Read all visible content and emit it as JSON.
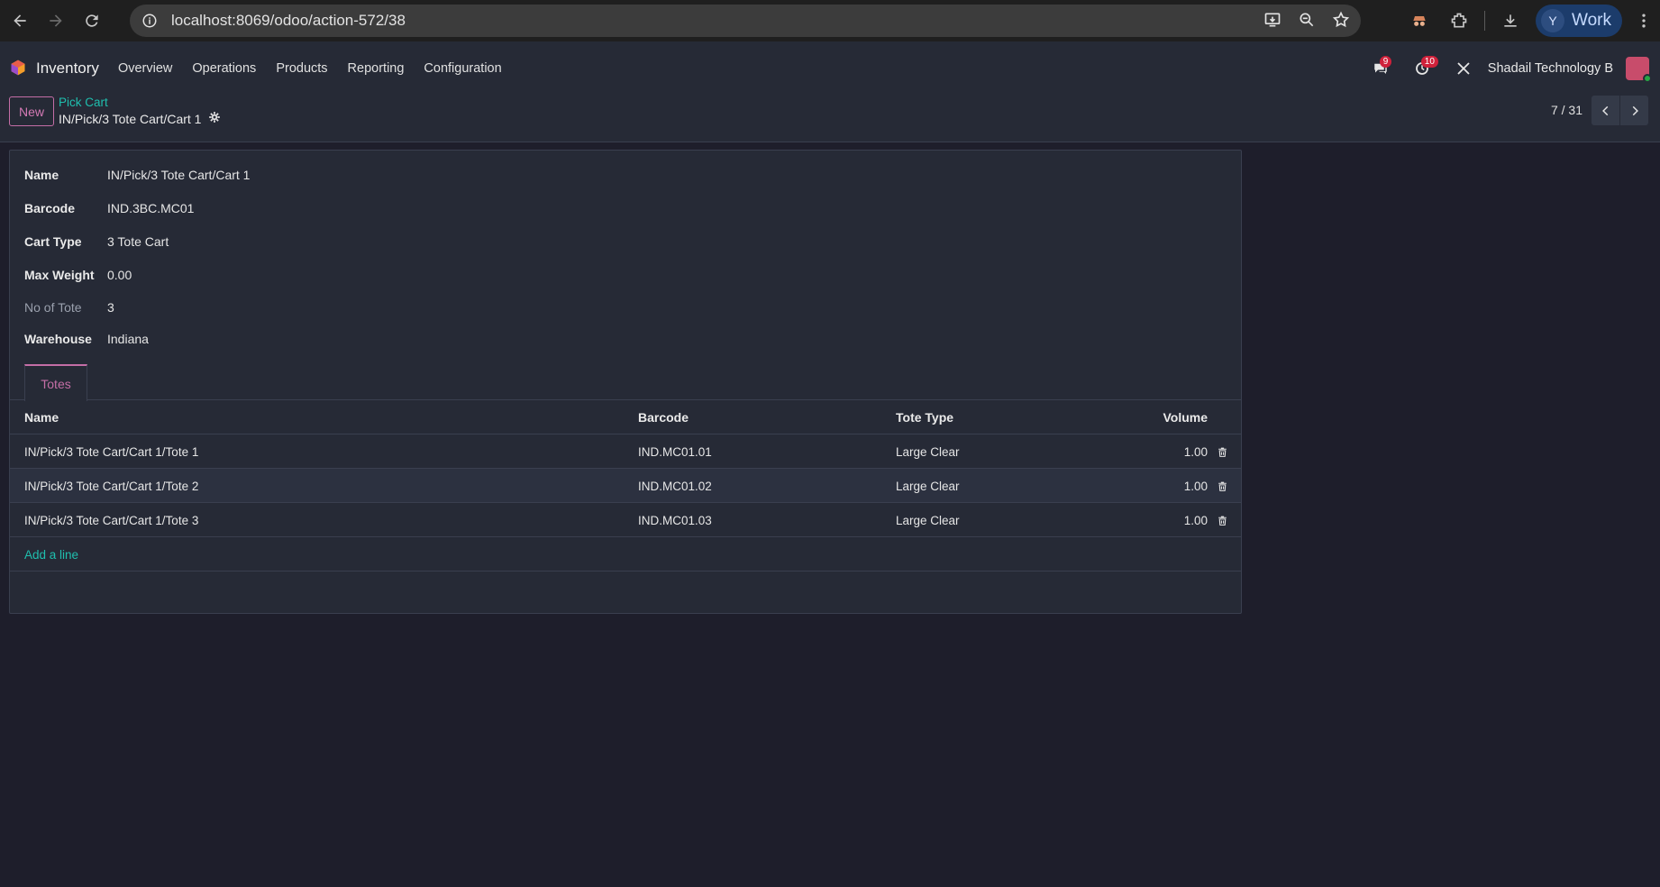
{
  "browser": {
    "url": "localhost:8069/odoo/action-572/38",
    "profile_initial": "Y",
    "profile_label": "Work"
  },
  "navbar": {
    "app_name": "Inventory",
    "menu": [
      "Overview",
      "Operations",
      "Products",
      "Reporting",
      "Configuration"
    ],
    "messages_count": "9",
    "activities_count": "10",
    "company": "Shadail Technology B"
  },
  "control_panel": {
    "new_label": "New",
    "breadcrumb_parent": "Pick Cart",
    "breadcrumb_current": "IN/Pick/3 Tote Cart/Cart 1",
    "pager": "7 / 31"
  },
  "form": {
    "fields": [
      {
        "label": "Name",
        "value": "IN/Pick/3 Tote Cart/Cart 1"
      },
      {
        "label": "Barcode",
        "value": "IND.3BC.MC01"
      },
      {
        "label": "Cart Type",
        "value": "3 Tote Cart"
      },
      {
        "label": "Max Weight",
        "value": "0.00"
      },
      {
        "label": "No of Tote",
        "value": "3"
      },
      {
        "label": "Warehouse",
        "value": "Indiana"
      }
    ],
    "tab_label": "Totes",
    "columns": {
      "name": "Name",
      "barcode": "Barcode",
      "tote_type": "Tote Type",
      "volume": "Volume"
    },
    "rows": [
      {
        "name": "IN/Pick/3 Tote Cart/Cart 1/Tote 1",
        "barcode": "IND.MC01.01",
        "tote_type": "Large Clear",
        "volume": "1.00"
      },
      {
        "name": "IN/Pick/3 Tote Cart/Cart 1/Tote 2",
        "barcode": "IND.MC01.02",
        "tote_type": "Large Clear",
        "volume": "1.00"
      },
      {
        "name": "IN/Pick/3 Tote Cart/Cart 1/Tote 3",
        "barcode": "IND.MC01.03",
        "tote_type": "Large Clear",
        "volume": "1.00"
      }
    ],
    "add_line_label": "Add a line"
  },
  "colors": {
    "accent": "#c46ea6",
    "link": "#1fbfae",
    "background": "#1e1e2b",
    "surface": "#262a36"
  }
}
